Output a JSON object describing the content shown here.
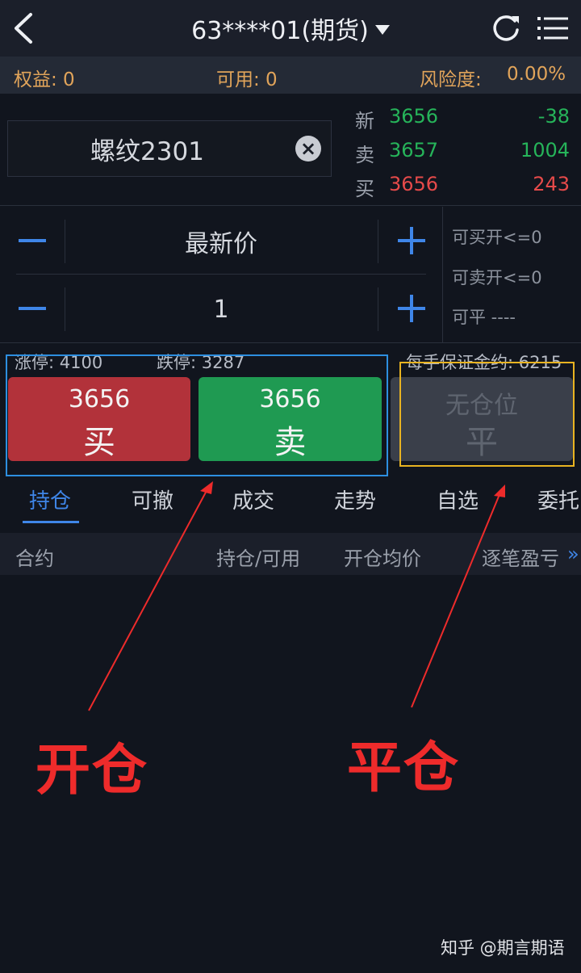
{
  "header": {
    "account_title": "63****01(期货)"
  },
  "account": {
    "equity": "权益: 0",
    "available": "可用: 0",
    "risk_label": "风险度:",
    "risk_value": "0.00%"
  },
  "contract": {
    "name": "螺纹2301"
  },
  "quote": {
    "rows": [
      {
        "label": "新",
        "price": "3656",
        "change": "-38"
      },
      {
        "label": "卖",
        "price": "3657",
        "change": "1004"
      },
      {
        "label": "买",
        "price": "3656",
        "change": "243"
      }
    ]
  },
  "order": {
    "price_type": "最新价",
    "quantity": "1",
    "can_buy_open": "可买开<=0",
    "can_sell_open": "可卖开<=0",
    "can_close": "可平 ----"
  },
  "limits": {
    "limit_up": "涨停: 4100",
    "limit_down": "跌停: 3287",
    "margin": "每手保证金约: 6215"
  },
  "buttons": {
    "buy_price": "3656",
    "buy_label": "买",
    "sell_price": "3656",
    "sell_label": "卖",
    "close_status": "无仓位",
    "close_label": "平"
  },
  "tabs": [
    "持仓",
    "可撤",
    "成交",
    "走势",
    "自选",
    "委托"
  ],
  "table": {
    "columns": [
      "合约",
      "持仓/可用",
      "开仓均价",
      "逐笔盈亏"
    ],
    "more": "»"
  },
  "annotations": {
    "open": "开仓",
    "close": "平仓"
  },
  "watermark": "知乎 @期言期语",
  "colors": {
    "accent": "#3f86e8",
    "buy": "#b2323a",
    "sell": "#1f9a52",
    "annotation": "#ee2b2b",
    "highlight_blue": "#2d8fe0",
    "highlight_yellow": "#e8b321"
  }
}
